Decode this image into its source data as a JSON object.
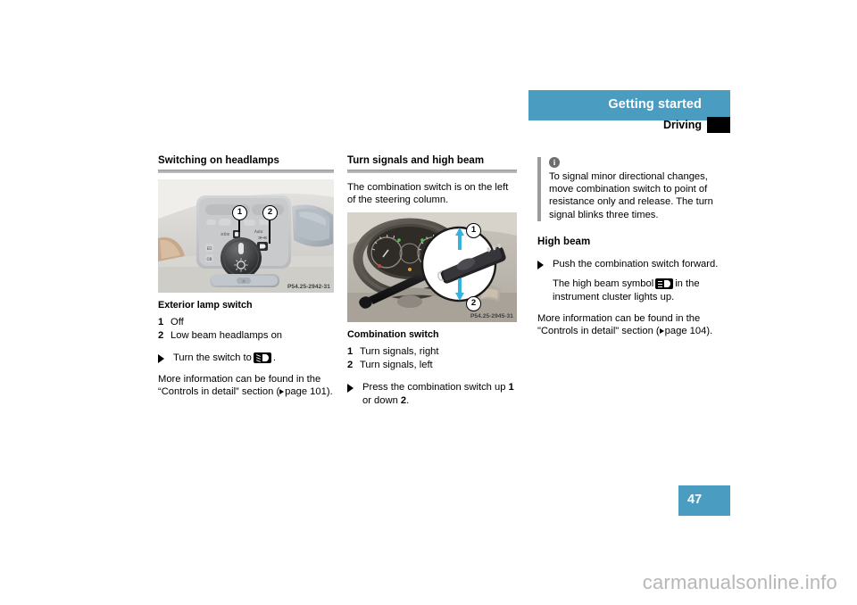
{
  "header": {
    "banner_title": "Getting started",
    "section_title": "Driving"
  },
  "page_number": "47",
  "watermark": "carmanualsonline.info",
  "columns": {
    "left": {
      "heading": "Switching on headlamps",
      "figure": {
        "code": "P54.25-2942-31",
        "callouts": [
          "1",
          "2"
        ],
        "alt_name": "exterior-lamp-switch-photo"
      },
      "caption": "Exterior lamp switch",
      "legend": [
        {
          "num": "1",
          "text": "Off"
        },
        {
          "num": "2",
          "text": "Low beam headlamps on"
        }
      ],
      "instruction_pre": "Turn the switch to",
      "instruction_post": ".",
      "more_info_line1": "More information can be found in the",
      "more_info_line2_pre": "“Controls in detail” section (",
      "more_info_page": "page 101",
      "more_info_line2_post": ")."
    },
    "middle": {
      "heading": "Turn signals and high beam",
      "intro": "The combination switch is on the left of the steering column.",
      "figure": {
        "code": "P54.25-2945-31",
        "callouts": [
          "1",
          "2"
        ],
        "alt_name": "combination-switch-photo"
      },
      "caption": "Combination switch",
      "legend": [
        {
          "num": "1",
          "text": "Turn signals, right"
        },
        {
          "num": "2",
          "text": "Turn signals, left"
        }
      ],
      "instruction_parts": {
        "a": "Press the combination switch up ",
        "b": "1",
        "c": " or down ",
        "d": "2",
        "e": "."
      }
    },
    "right": {
      "info_icon": "info-icon",
      "info_text": "To signal minor directional changes, move combination switch to point of resistance only and release. The turn signal blinks three times.",
      "heading": "High beam",
      "instruction": "Push the combination switch forward.",
      "sub_note_pre": "The high beam symbol",
      "sub_note_post": "in the instrument cluster lights up.",
      "more_info_line1": "More information can be found in the",
      "more_info_line2_pre": "\"Controls in detail\" section (",
      "more_info_page": "page 104",
      "more_info_line2_post": ")."
    }
  },
  "colors": {
    "banner": "#4a9cc0",
    "rule": "#a8a8a8",
    "info_bar": "#9b9b9b",
    "watermark": "#b7b7b7"
  }
}
